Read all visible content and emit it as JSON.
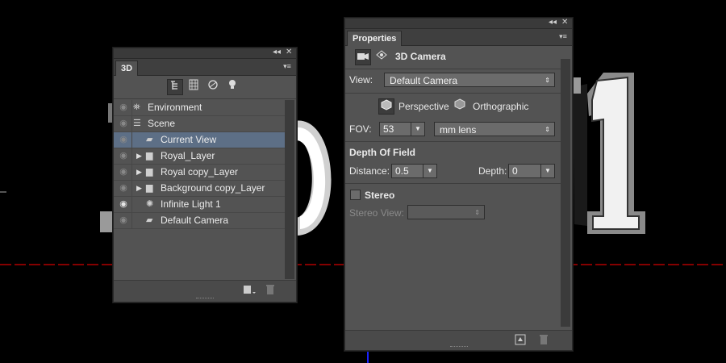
{
  "panel_3d": {
    "tab_label": "3D",
    "collapse_glyph": "◂◂",
    "close_glyph": "✕",
    "menu_glyph": "▾≡",
    "toolbar_icons": [
      "scene-filter-icon",
      "mesh-filter-icon",
      "material-filter-icon",
      "light-filter-icon"
    ],
    "layers": [
      {
        "label": "Environment",
        "icon": "environment-icon",
        "indent": 0,
        "expand": false,
        "selected": false,
        "visible": false
      },
      {
        "label": "Scene",
        "icon": "scene-icon",
        "indent": 0,
        "expand": false,
        "selected": false,
        "visible": false
      },
      {
        "label": "Current View",
        "icon": "camera-icon",
        "indent": 1,
        "expand": false,
        "selected": true,
        "visible": false
      },
      {
        "label": "Royal_Layer",
        "icon": "folder-icon",
        "indent": 1,
        "expand": true,
        "selected": false,
        "visible": false
      },
      {
        "label": "Royal copy_Layer",
        "icon": "folder-icon",
        "indent": 1,
        "expand": true,
        "selected": false,
        "visible": false
      },
      {
        "label": "Background copy_Layer",
        "icon": "folder-icon",
        "indent": 1,
        "expand": true,
        "selected": false,
        "visible": false
      },
      {
        "label": "Infinite Light 1",
        "icon": "light-icon",
        "indent": 1,
        "expand": false,
        "selected": false,
        "visible": true
      },
      {
        "label": "Default Camera",
        "icon": "camera-icon",
        "indent": 1,
        "expand": false,
        "selected": false,
        "visible": false
      }
    ]
  },
  "properties_panel": {
    "tab_label": "Properties",
    "collapse_glyph": "◂◂",
    "close_glyph": "✕",
    "menu_glyph": "▾≡",
    "title": "3D Camera",
    "view_label": "View:",
    "view_value": "Default Camera",
    "perspective_label": "Perspective",
    "orthographic_label": "Orthographic",
    "fov_label": "FOV:",
    "fov_value": "53",
    "lens_value": "mm lens",
    "dof_title": "Depth Of Field",
    "distance_label": "Distance:",
    "distance_value": "0.5",
    "depth_label": "Depth:",
    "depth_value": "0",
    "stereo_label": "Stereo",
    "stereo_view_label": "Stereo View:"
  },
  "colors": {
    "panel_bg": "#535353",
    "selection": "#5d6f86",
    "guide_red": "#c00000",
    "guide_blue": "#1a22ff"
  }
}
